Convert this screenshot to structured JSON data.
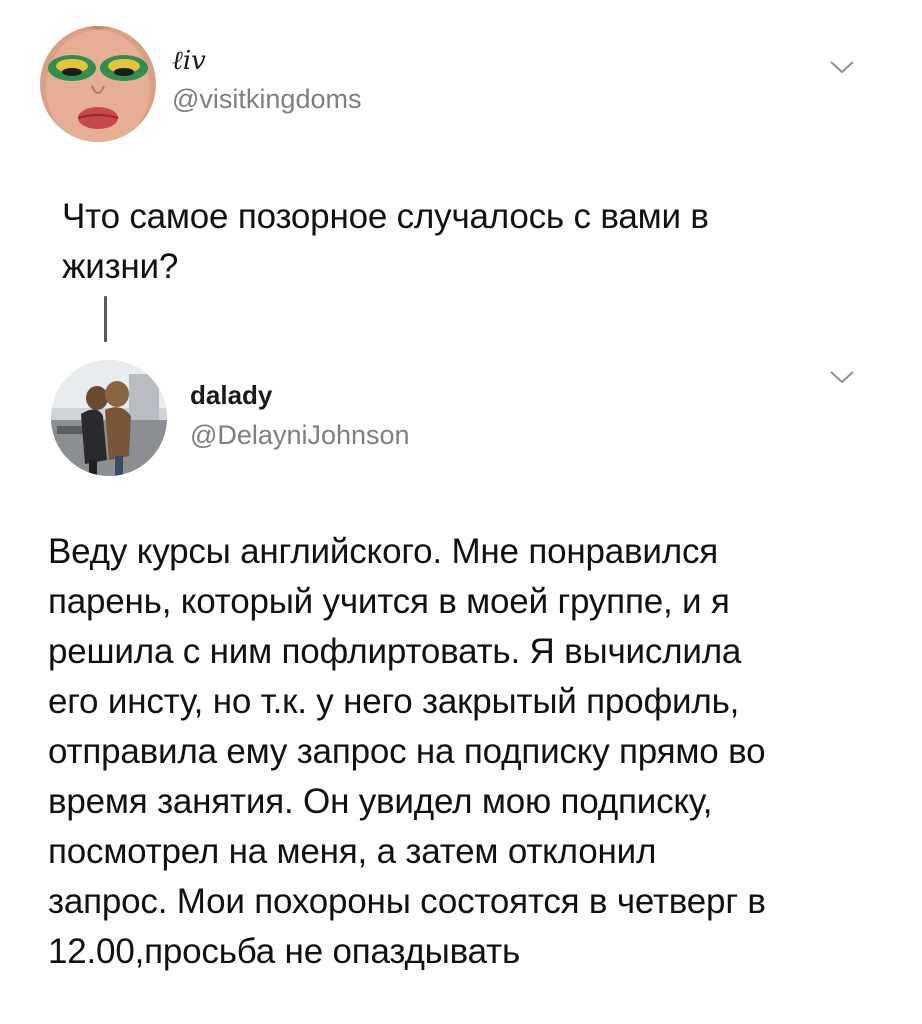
{
  "tweet1": {
    "display_name": "ℓiv",
    "handle": "@visitkingdoms",
    "text_lines": [
      "Что самое позорное случалось с вами в",
      "жизни?"
    ],
    "avatar_icon": "avatar-glam-makeup-face",
    "menu_icon": "chevron-down-icon"
  },
  "tweet2": {
    "display_name": "dalady",
    "handle": "@DelayniJohnson",
    "text_lines": [
      "Веду курсы английского. Мне понравился",
      "парень, который учится в моей группе, и я",
      "решила с ним пофлиртовать. Я вычислила",
      "его инсту, но т.к. у него закрытый профиль,",
      "отправила ему запрос на подписку прямо во",
      "время занятия. Он увидел мою подписку,",
      "посмотрел на меня, а затем отклонил",
      "запрос. Мои похороны состоятся в четверг в",
      "12.00,просьба не опаздывать"
    ],
    "avatar_icon": "avatar-two-people-photo",
    "menu_icon": "chevron-down-icon"
  },
  "colors": {
    "text": "#111111",
    "handle": "#7a7f84",
    "thread_line": "#555a5e",
    "chevron": "#8a9096"
  }
}
